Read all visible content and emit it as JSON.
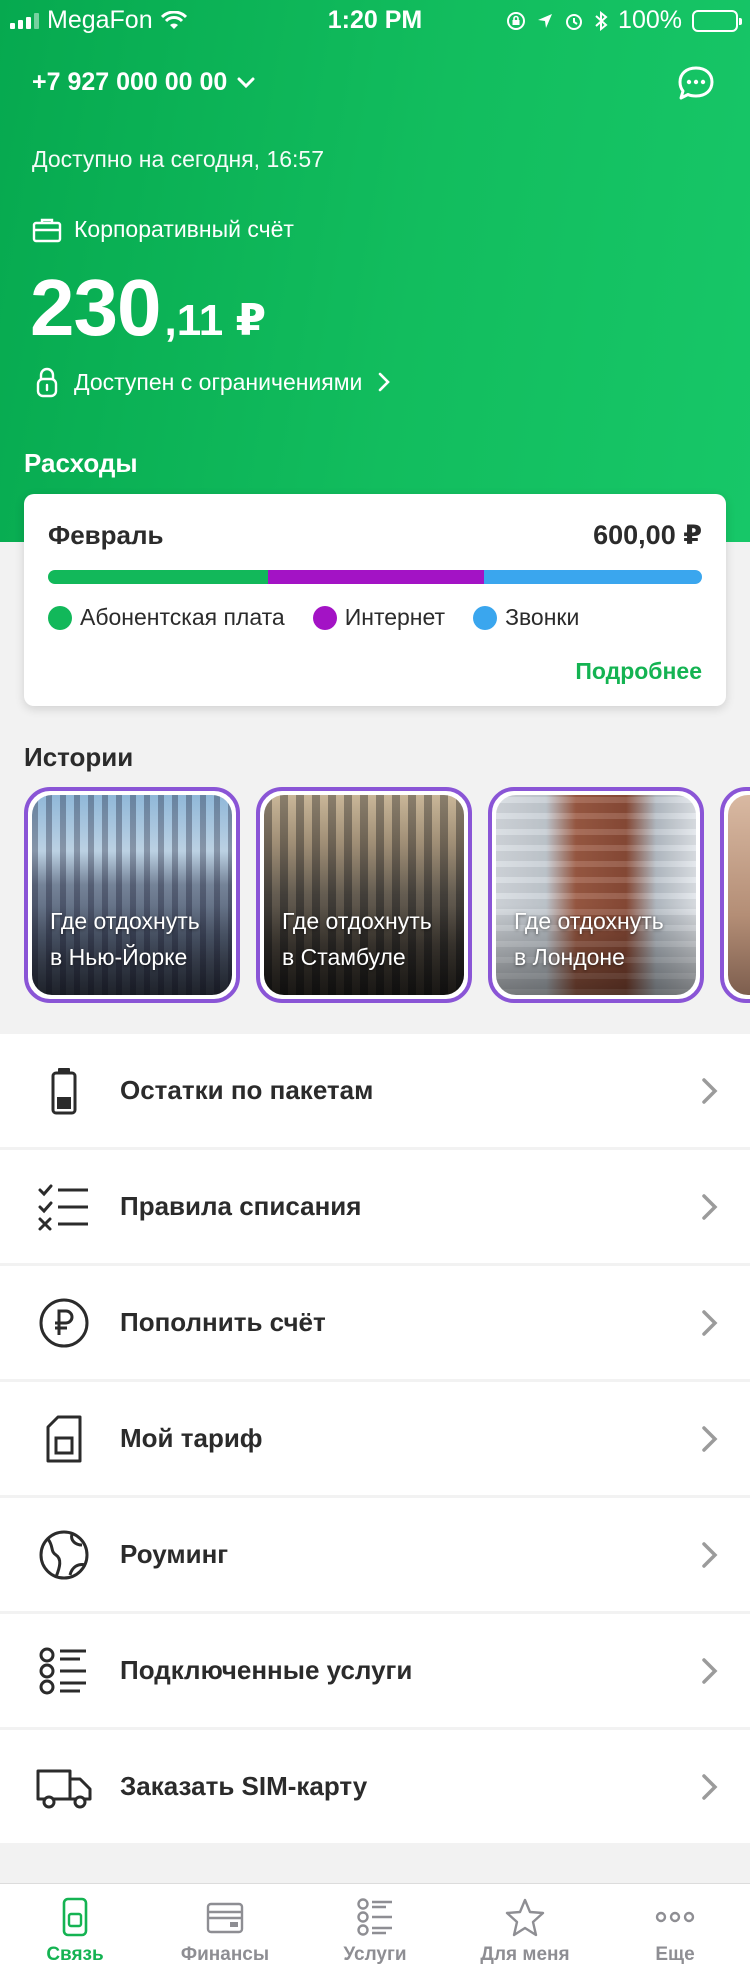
{
  "status_bar": {
    "carrier": "MegaFon",
    "time": "1:20 PM",
    "battery": "100%"
  },
  "header": {
    "phone": "+7 927 000 00 00",
    "available_label": "Доступно на сегодня, 16:57",
    "account_type": "Корпоративный счёт",
    "balance_int": "230",
    "balance_frac": ",11 ₽",
    "restriction": "Доступен с ограничениями"
  },
  "expenses": {
    "title": "Расходы",
    "month": "Февраль",
    "total": "600,00 ₽",
    "segments": [
      {
        "name": "Абонентская плата",
        "share": 0.336,
        "color": "#12b85a"
      },
      {
        "name": "Интернет",
        "share": 0.33,
        "color": "#a313c5"
      },
      {
        "name": "Звонки",
        "share": 0.334,
        "color": "#3aa6ee"
      }
    ],
    "more_label": "Подробнее"
  },
  "stories": {
    "title": "Истории",
    "items": [
      {
        "line1": "Где отдохнуть",
        "line2": "в Нью-Йорке"
      },
      {
        "line1": "Где отдохнуть",
        "line2": "в Стамбуле"
      },
      {
        "line1": "Где отдохнуть",
        "line2": "в Лондоне"
      }
    ]
  },
  "menu": [
    {
      "label": "Остатки по пакетам",
      "icon": "battery-icon"
    },
    {
      "label": "Правила списания",
      "icon": "rules-list-icon"
    },
    {
      "label": "Пополнить счёт",
      "icon": "ruble-icon"
    },
    {
      "label": "Мой тариф",
      "icon": "sim-card-icon"
    },
    {
      "label": "Роуминг",
      "icon": "globe-icon"
    },
    {
      "label": "Подключенные услуги",
      "icon": "services-list-icon"
    },
    {
      "label": "Заказать SIM-карту",
      "icon": "delivery-truck-icon"
    }
  ],
  "tabbar": {
    "active_color": "#14b352",
    "items": [
      {
        "label": "Связь",
        "icon": "phone-icon",
        "active": true
      },
      {
        "label": "Финансы",
        "icon": "wallet-icon",
        "active": false
      },
      {
        "label": "Услуги",
        "icon": "services-icon",
        "active": false
      },
      {
        "label": "Для меня",
        "icon": "star-icon",
        "active": false
      },
      {
        "label": "Еще",
        "icon": "more-icon",
        "active": false
      }
    ]
  }
}
